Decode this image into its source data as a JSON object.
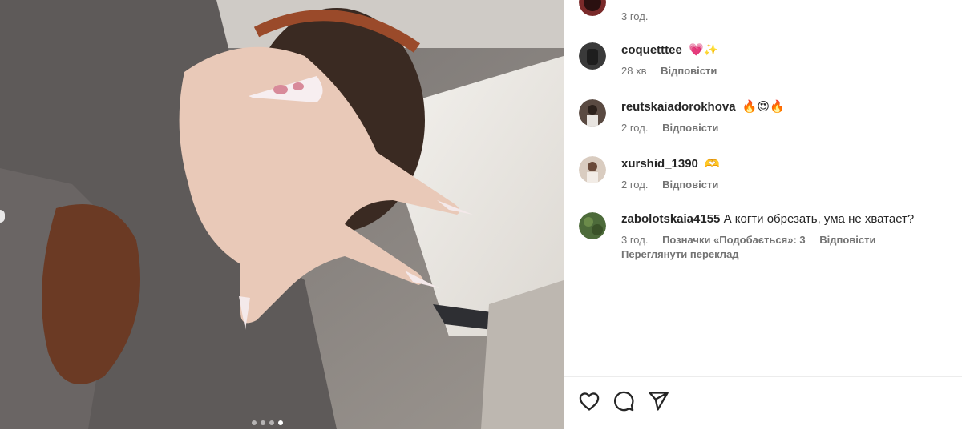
{
  "post": {
    "photo_dots_total": 4,
    "photo_dots_active_index": 3
  },
  "comments": [
    {
      "username": "",
      "text": "",
      "time": "3 год.",
      "reply_label": "",
      "avatar_color": "#7a2a2a"
    },
    {
      "username": "coquetttee",
      "text": "",
      "emojis": "💗✨",
      "time": "28 хв",
      "reply_label": "Відповісти",
      "avatar_color": "#3a3a3a"
    },
    {
      "username": "reutskaiadorokhova",
      "text": "",
      "emojis": "🔥😍🔥",
      "time": "2 год.",
      "reply_label": "Відповісти",
      "avatar_color": "#5a4a42"
    },
    {
      "username": "xurshid_1390",
      "text": "",
      "emojis": "🫶",
      "time": "2 год.",
      "reply_label": "Відповісти",
      "avatar_color": "#c9b8a8"
    },
    {
      "username": "zabolotskaia4155",
      "text": "А когти обрезать, ума не хватает?",
      "time": "3 год.",
      "likes_label": "Позначки «Подобається»: 3",
      "reply_label": "Відповісти",
      "translate_label": "Переглянути переклад",
      "avatar_color": "#4d6b3a"
    }
  ],
  "actions": {
    "like_icon": "heart-icon",
    "comment_icon": "comment-icon",
    "share_icon": "send-icon"
  },
  "colors": {
    "text_primary": "#262626",
    "text_secondary": "#737373",
    "divider": "#dbdbdb"
  }
}
